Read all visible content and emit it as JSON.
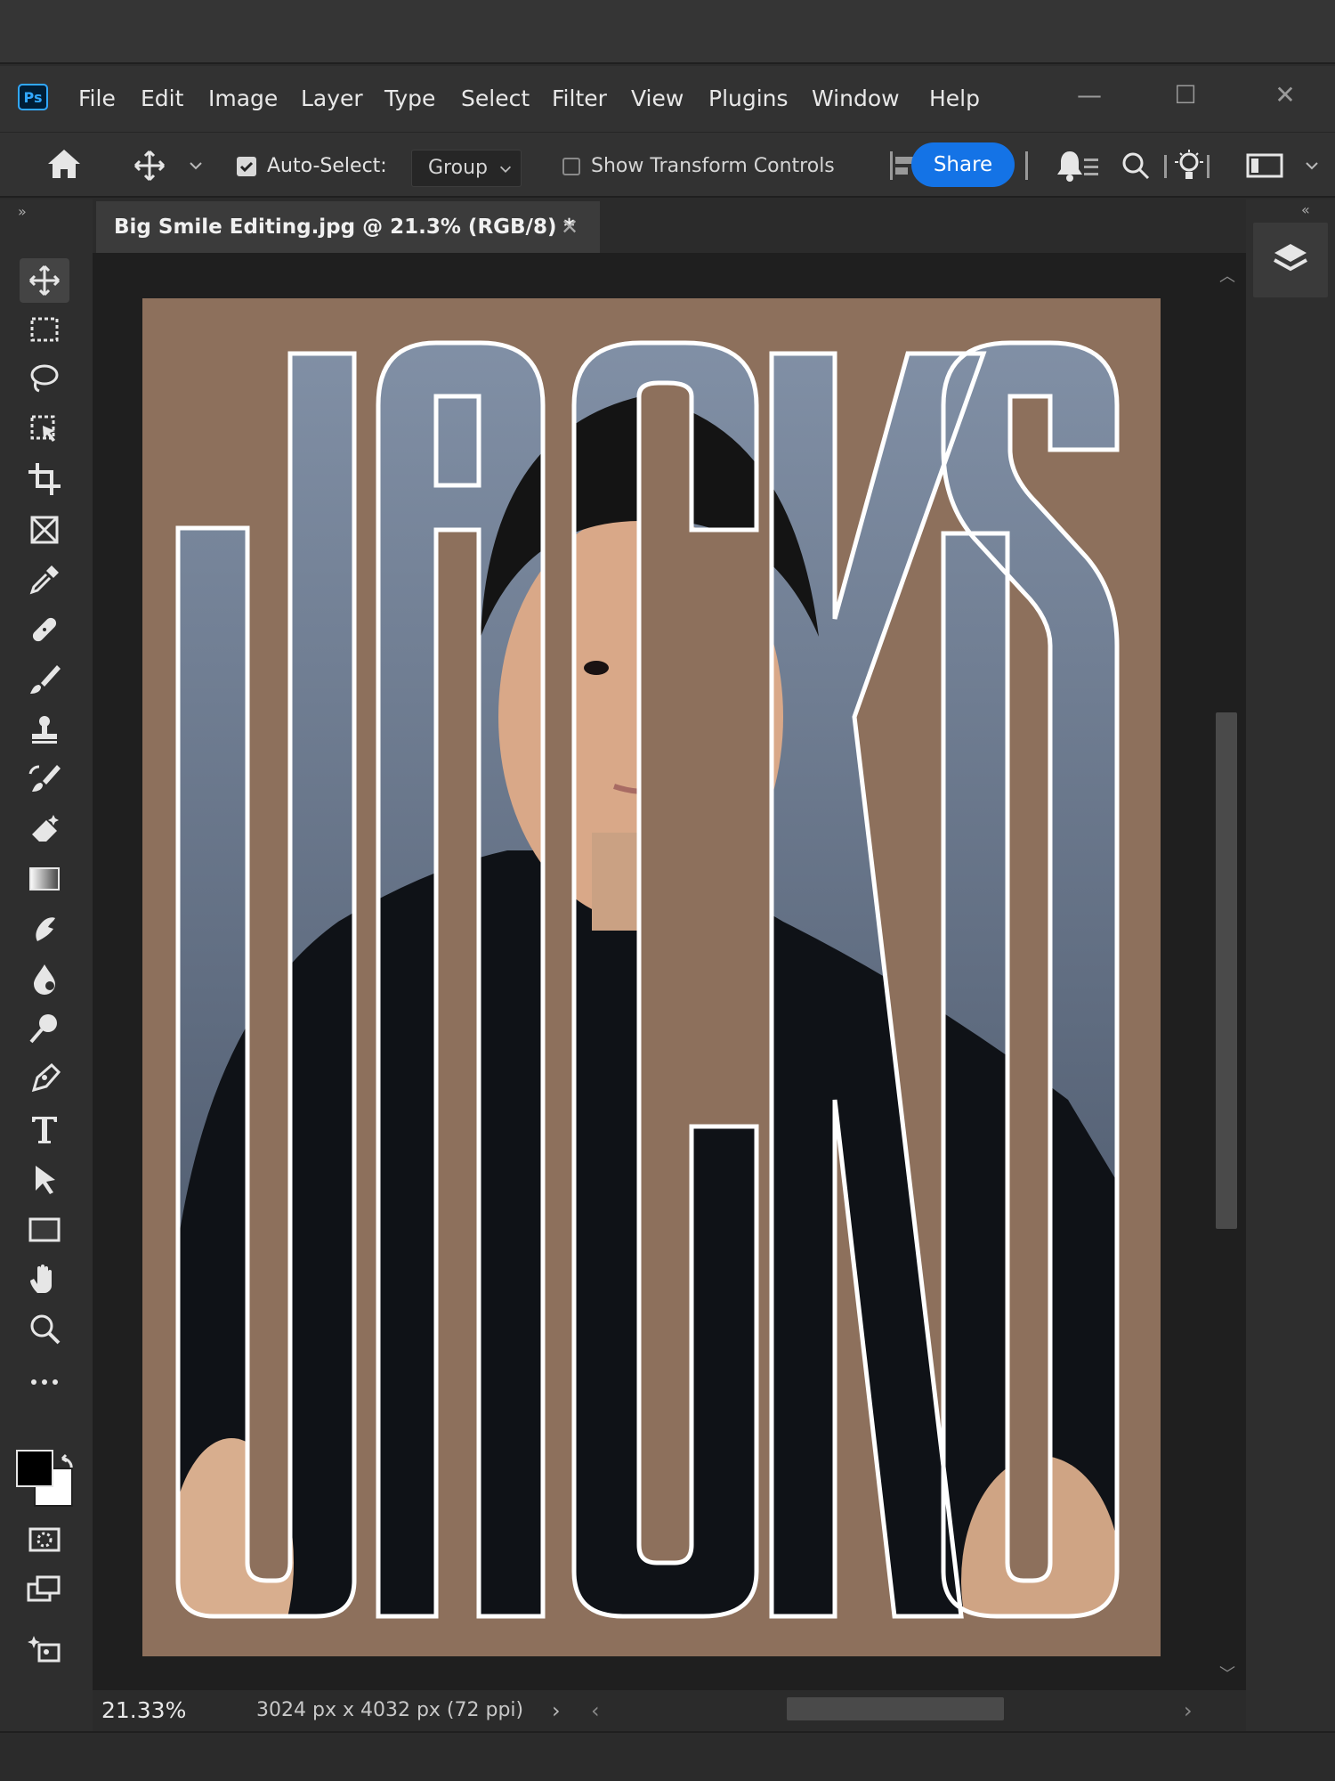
{
  "app": {
    "logo": "Ps"
  },
  "menu": [
    "File",
    "Edit",
    "Image",
    "Layer",
    "Type",
    "Select",
    "Filter",
    "View",
    "Plugins",
    "Window",
    "Help"
  ],
  "window_controls": {
    "minimize": "—",
    "maximize": "☐",
    "close": "✕"
  },
  "options_bar": {
    "auto_select_label": "Auto-Select:",
    "auto_select_checked": true,
    "auto_select_mode": "Group",
    "show_transform_label": "Show Transform Controls",
    "show_transform_checked": false,
    "share_label": "Share"
  },
  "document": {
    "tab_title": "Big Smile Editing.jpg @ 21.3% (RGB/8) *",
    "canvas_text": "JACKS",
    "canvas_bg": "#8d705c",
    "letter_fill": "#6f7f94"
  },
  "status": {
    "zoom": "21.33%",
    "doc_info": "3024 px x 4032 px (72 ppi)",
    "arrow": "›"
  },
  "colors": {
    "accent": "#1473e6",
    "foreground": "#000000",
    "background": "#ffffff"
  },
  "tools": [
    "move-icon",
    "marquee-icon",
    "lasso-icon",
    "object-select-icon",
    "crop-icon",
    "frame-icon",
    "eyedropper-icon",
    "healing-icon",
    "brush-icon",
    "stamp-icon",
    "history-brush-icon",
    "eraser-icon",
    "gradient-icon",
    "smudge-icon",
    "blur-icon",
    "dodge-icon",
    "pen-icon",
    "type-icon",
    "path-select-icon",
    "rectangle-icon",
    "hand-icon",
    "zoom-icon",
    "more-icon"
  ]
}
